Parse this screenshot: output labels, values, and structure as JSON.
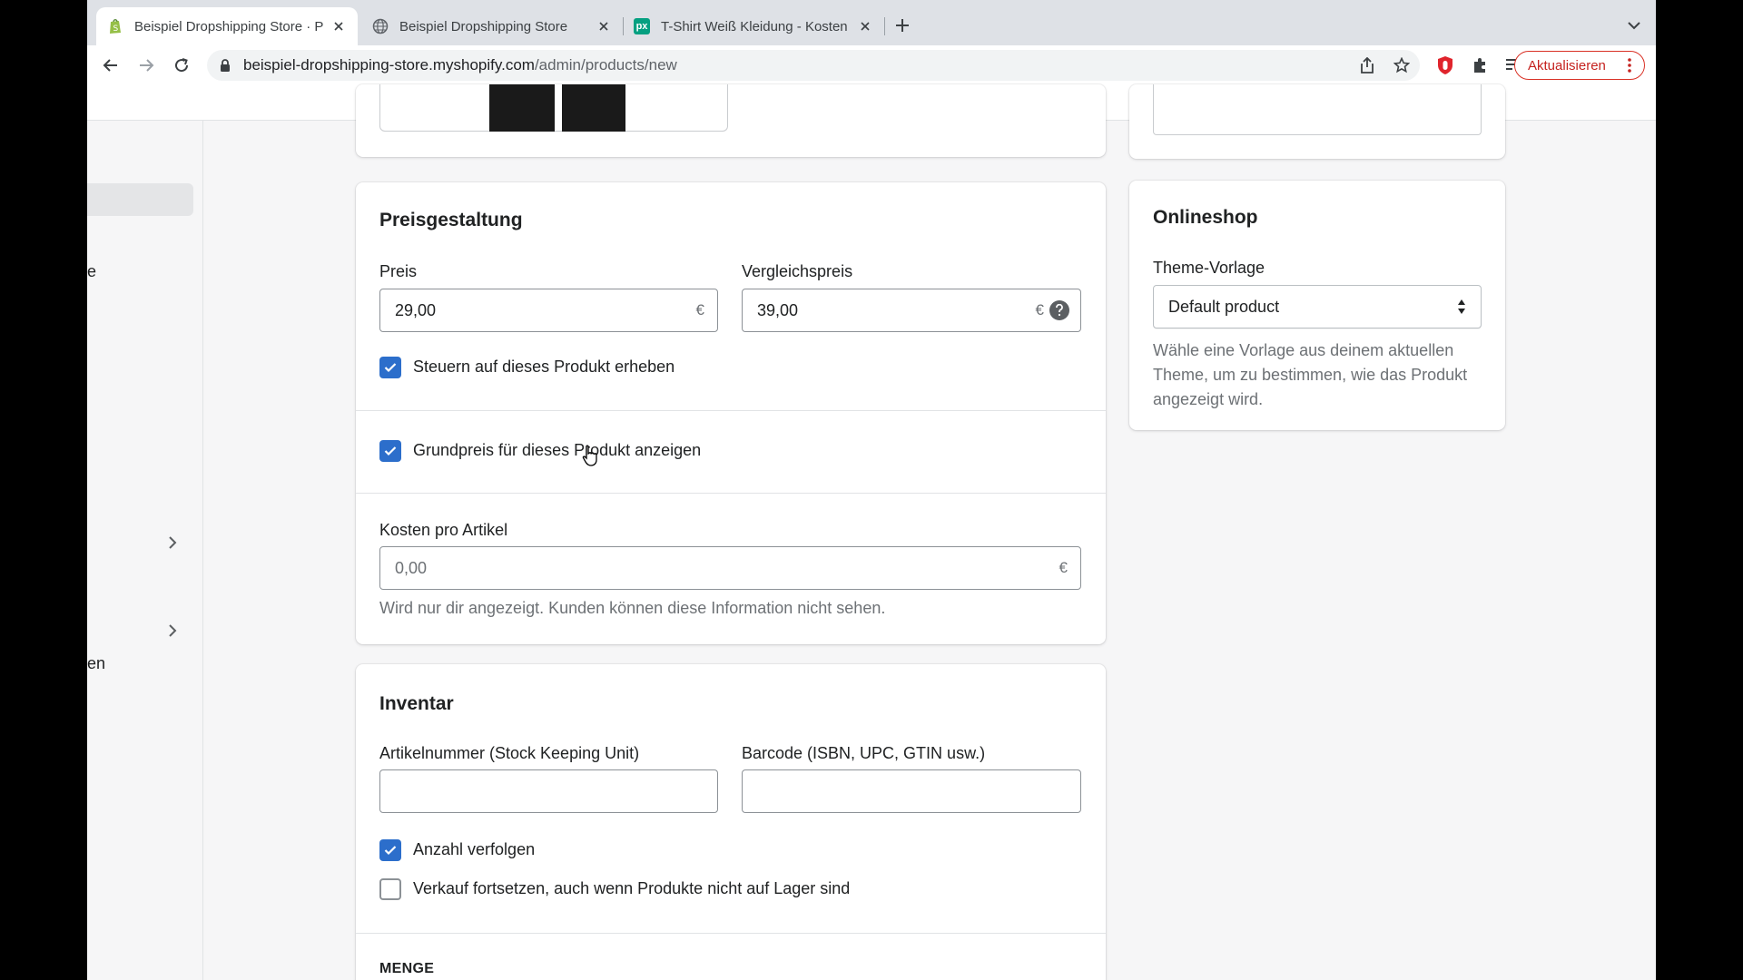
{
  "browser": {
    "tabs": [
      {
        "title": "Beispiel Dropshipping Store · P",
        "favicon": "shopify-icon",
        "active": true
      },
      {
        "title": "Beispiel Dropshipping Store",
        "favicon": "globe-icon",
        "active": false
      },
      {
        "title": "T-Shirt Weiß Kleidung - Kosten",
        "favicon": "pexels-icon",
        "active": false
      }
    ],
    "url": {
      "host": "beispiel-dropshipping-store.myshopify.com",
      "path": "/admin/products/new"
    },
    "update_button": "Aktualisieren",
    "pexels_badge": "px"
  },
  "sidebar": {
    "fragments": [
      "e",
      "en"
    ]
  },
  "pricing": {
    "title": "Preisgestaltung",
    "price_label": "Preis",
    "price_value": "29,00",
    "compare_label": "Vergleichspreis",
    "compare_value": "39,00",
    "currency": "€",
    "charge_tax_label": "Steuern auf dieses Produkt erheben",
    "charge_tax_checked": true,
    "unit_price_label": "Grundpreis für dieses Produkt anzeigen",
    "unit_price_checked": true,
    "cost_label": "Kosten pro Artikel",
    "cost_placeholder": "0,00",
    "cost_help": "Wird nur dir angezeigt. Kunden können diese Information nicht sehen."
  },
  "inventory": {
    "title": "Inventar",
    "sku_label": "Artikelnummer (Stock Keeping Unit)",
    "sku_value": "",
    "barcode_label": "Barcode (ISBN, UPC, GTIN usw.)",
    "barcode_value": "",
    "track_label": "Anzahl verfolgen",
    "track_checked": true,
    "continue_label": "Verkauf fortsetzen, auch wenn Produkte nicht auf Lager sind",
    "continue_checked": false,
    "quantity_heading": "MENGE"
  },
  "online_store": {
    "title": "Onlineshop",
    "template_label": "Theme-Vorlage",
    "template_value": "Default product",
    "template_help": "Wähle eine Vorlage aus deinem aktuellen Theme, um zu bestimmen, wie das Produkt angezeigt wird."
  },
  "colors": {
    "accent": "#2c6ecb",
    "update_red": "#d93025"
  }
}
